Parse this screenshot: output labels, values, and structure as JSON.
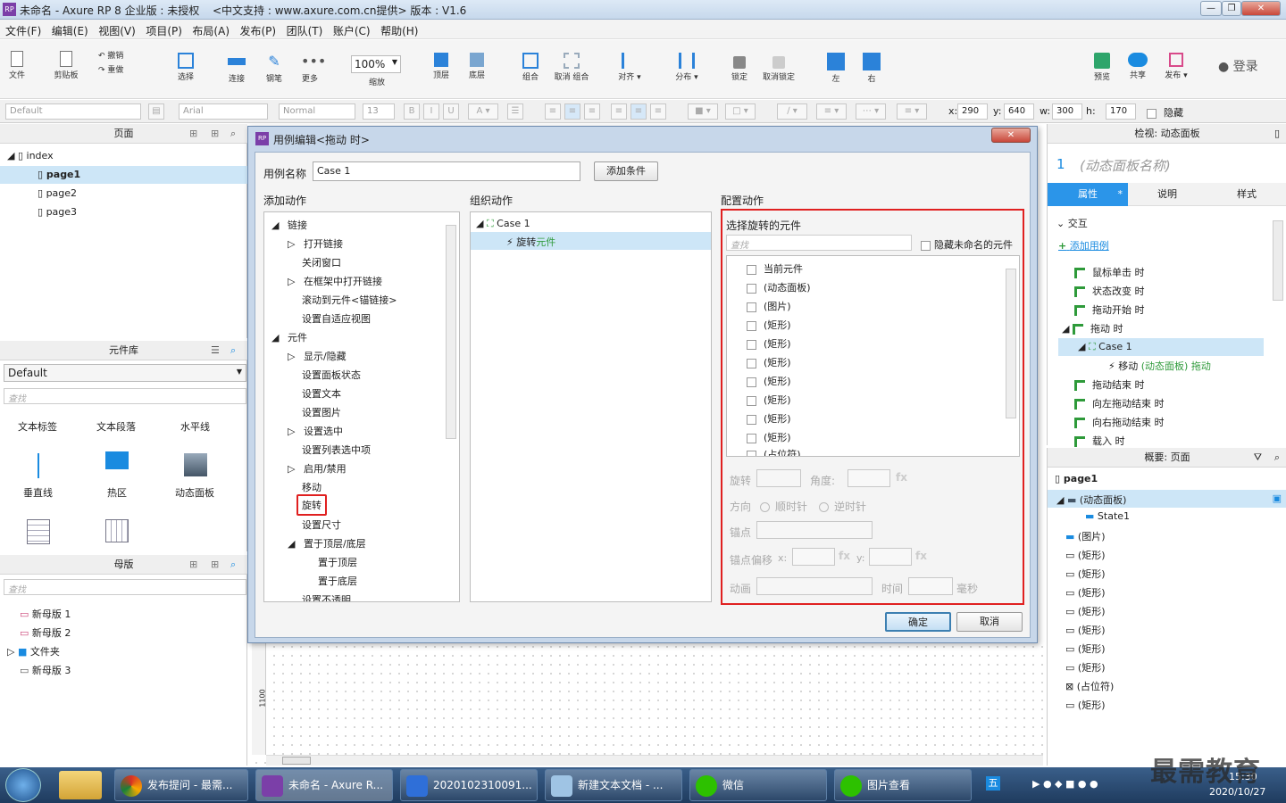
{
  "window": {
    "title": "未命名 - Axure RP 8 企业版 : 未授权",
    "subtitle": "<中文支持 : www.axure.com.cn提供> 版本 : V1.6"
  },
  "menu": [
    "文件(F)",
    "编辑(E)",
    "视图(V)",
    "项目(P)",
    "布局(A)",
    "发布(P)",
    "团队(T)",
    "账户(C)",
    "帮助(H)"
  ],
  "toolbar": {
    "file": "文件",
    "clipboard": "剪贴板",
    "undo": "撤销",
    "redo": "重做",
    "select": "选择",
    "connect": "连接",
    "pen": "钢笔",
    "more": "更多",
    "zoom": "100%",
    "zoom_label": "缩放",
    "top": "顶层",
    "bottom": "底层",
    "group": "组合",
    "ungroup": "取消 组合",
    "align": "对齐",
    "distribute": "分布",
    "lock": "锁定",
    "unlock": "取消锁定",
    "left": "左",
    "right": "右",
    "preview": "预览",
    "share": "共享",
    "publish": "发布",
    "login": "登录"
  },
  "format": {
    "style": "Default",
    "font": "Arial",
    "weight": "Normal",
    "size": "13",
    "x_label": "x:",
    "x": "290",
    "y_label": "y:",
    "y": "640",
    "w_label": "w:",
    "w": "300",
    "h_label": "h:",
    "h": "170",
    "hidden": "隐藏"
  },
  "pages": {
    "title": "页面",
    "root": "index",
    "items": [
      "page1",
      "page2",
      "page3"
    ]
  },
  "library": {
    "title": "元件库",
    "selected": "Default",
    "search": "查找",
    "widgets": [
      "文本标签",
      "文本段落",
      "水平线",
      "垂直线",
      "热区",
      "动态面板"
    ]
  },
  "masters": {
    "title": "母版",
    "search": "查找",
    "items": [
      "新母版 1",
      "新母版 2",
      "文件夹",
      "新母版 3"
    ]
  },
  "dialog": {
    "title": "用例编辑<拖动 时>",
    "case_name_label": "用例名称",
    "case_name": "Case 1",
    "add_condition": "添加条件",
    "add_action_label": "添加动作",
    "organize_label": "组织动作",
    "config_label": "配置动作",
    "actions": [
      "链接",
      "打开链接",
      "关闭窗口",
      "在框架中打开链接",
      "滚动到元件<锚链接>",
      "设置自适应视图",
      "元件",
      "显示/隐藏",
      "设置面板状态",
      "设置文本",
      "设置图片",
      "设置选中",
      "设置列表选中项",
      "启用/禁用",
      "移动",
      "旋转",
      "设置尺寸",
      "置于顶层/底层",
      "置于顶层",
      "置于底层",
      "设置不透明"
    ],
    "org_case": "Case 1",
    "org_action": "旋转",
    "org_action_target": "元件",
    "select_label": "选择旋转的元件",
    "search": "查找",
    "hide_unnamed": "隐藏未命名的元件",
    "widgets": [
      "当前元件",
      "(动态面板)",
      "(图片)",
      "(矩形)",
      "(矩形)",
      "(矩形)",
      "(矩形)",
      "(矩形)",
      "(矩形)",
      "(矩形)",
      "(占位符)"
    ],
    "rotate_label": "旋转",
    "angle_label": "角度:",
    "fx": "fx",
    "direction_label": "方向",
    "cw": "顺时针",
    "ccw": "逆时针",
    "anchor_label": "锚点",
    "anchor_offset_label": "锚点偏移",
    "ax": "x:",
    "ay": "y:",
    "anim_label": "动画",
    "time_label": "时间",
    "ms": "毫秒",
    "ok": "确定",
    "cancel": "取消"
  },
  "inspector": {
    "title": "检视: 动态面板",
    "name_index": "1",
    "name_placeholder": "(动态面板名称)",
    "tabs": [
      "属性",
      "说明",
      "样式"
    ],
    "section": "交互",
    "add_case": "添加用例",
    "events": [
      "鼠标单击 时",
      "状态改变 时",
      "拖动开始 时",
      "拖动 时",
      "Case 1",
      "移动",
      "(动态面板)",
      "拖动",
      "拖动结束 时",
      "向左拖动结束 时",
      "向右拖动结束 时",
      "载入 时"
    ]
  },
  "outline": {
    "title": "概要: 页面",
    "page": "page1",
    "items": [
      "(动态面板)",
      "State1",
      "(图片)",
      "(矩形)",
      "(矩形)",
      "(矩形)",
      "(矩形)",
      "(矩形)",
      "(矩形)",
      "(矩形)",
      "(占位符)",
      "(矩形)"
    ]
  },
  "canvas": {
    "ruler": "1100"
  },
  "taskbar": {
    "items": [
      "发布提问 - 最需...",
      "未命名 - Axure R...",
      "2020102310091...",
      "新建文本文档 - ...",
      "微信",
      "图片查看"
    ],
    "date": "2020/10/27",
    "time": "15:30",
    "watermark": "最需教育"
  },
  "colors": {
    "accent": "#1a8be0",
    "highlight": "#e02020",
    "tab_active": "#2b95e9"
  }
}
